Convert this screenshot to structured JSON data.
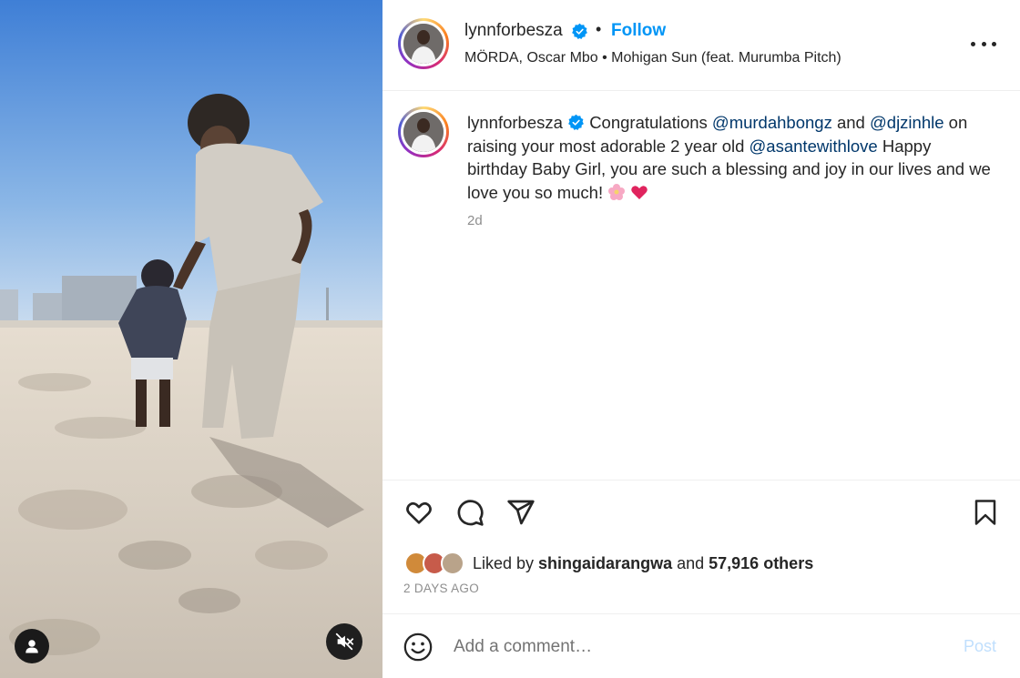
{
  "post": {
    "author": "lynnforbesza",
    "follow_label": "Follow",
    "separator": "•",
    "music": "MÖRDA, Oscar Mbo • Mohigan Sun (feat. Murumba Pitch)"
  },
  "caption": {
    "author": "lynnforbesza",
    "part1": "Congratulations ",
    "mention1": "@murdahbongz",
    "part2": " and ",
    "mention2": "@djzinhle",
    "part3": " on raising your most adorable 2 year old ",
    "mention3": "@asantewithlove",
    "part4": " Happy birthday Baby Girl, you are such a blessing and joy in our lives and we love you so much! ",
    "time_ago": "2d"
  },
  "likes": {
    "prefix": "Liked by ",
    "user": "shingaidarangwa",
    "middle": " and ",
    "count": "57,916 others",
    "date": "2 DAYS AGO"
  },
  "comment": {
    "placeholder": "Add a comment…",
    "post_label": "Post"
  },
  "icons": {
    "verified": "verified-badge-icon",
    "more": "more-options-icon",
    "like": "heart-icon",
    "comment": "comment-icon",
    "share": "send-icon",
    "save": "bookmark-icon",
    "emoji": "smiley-icon",
    "mute": "muted-speaker-icon",
    "tag": "user-tag-icon"
  },
  "colors": {
    "accent": "#0095f6",
    "mention": "#00376b",
    "muted": "#8e8e8e",
    "post_disabled": "#c0dffd"
  }
}
